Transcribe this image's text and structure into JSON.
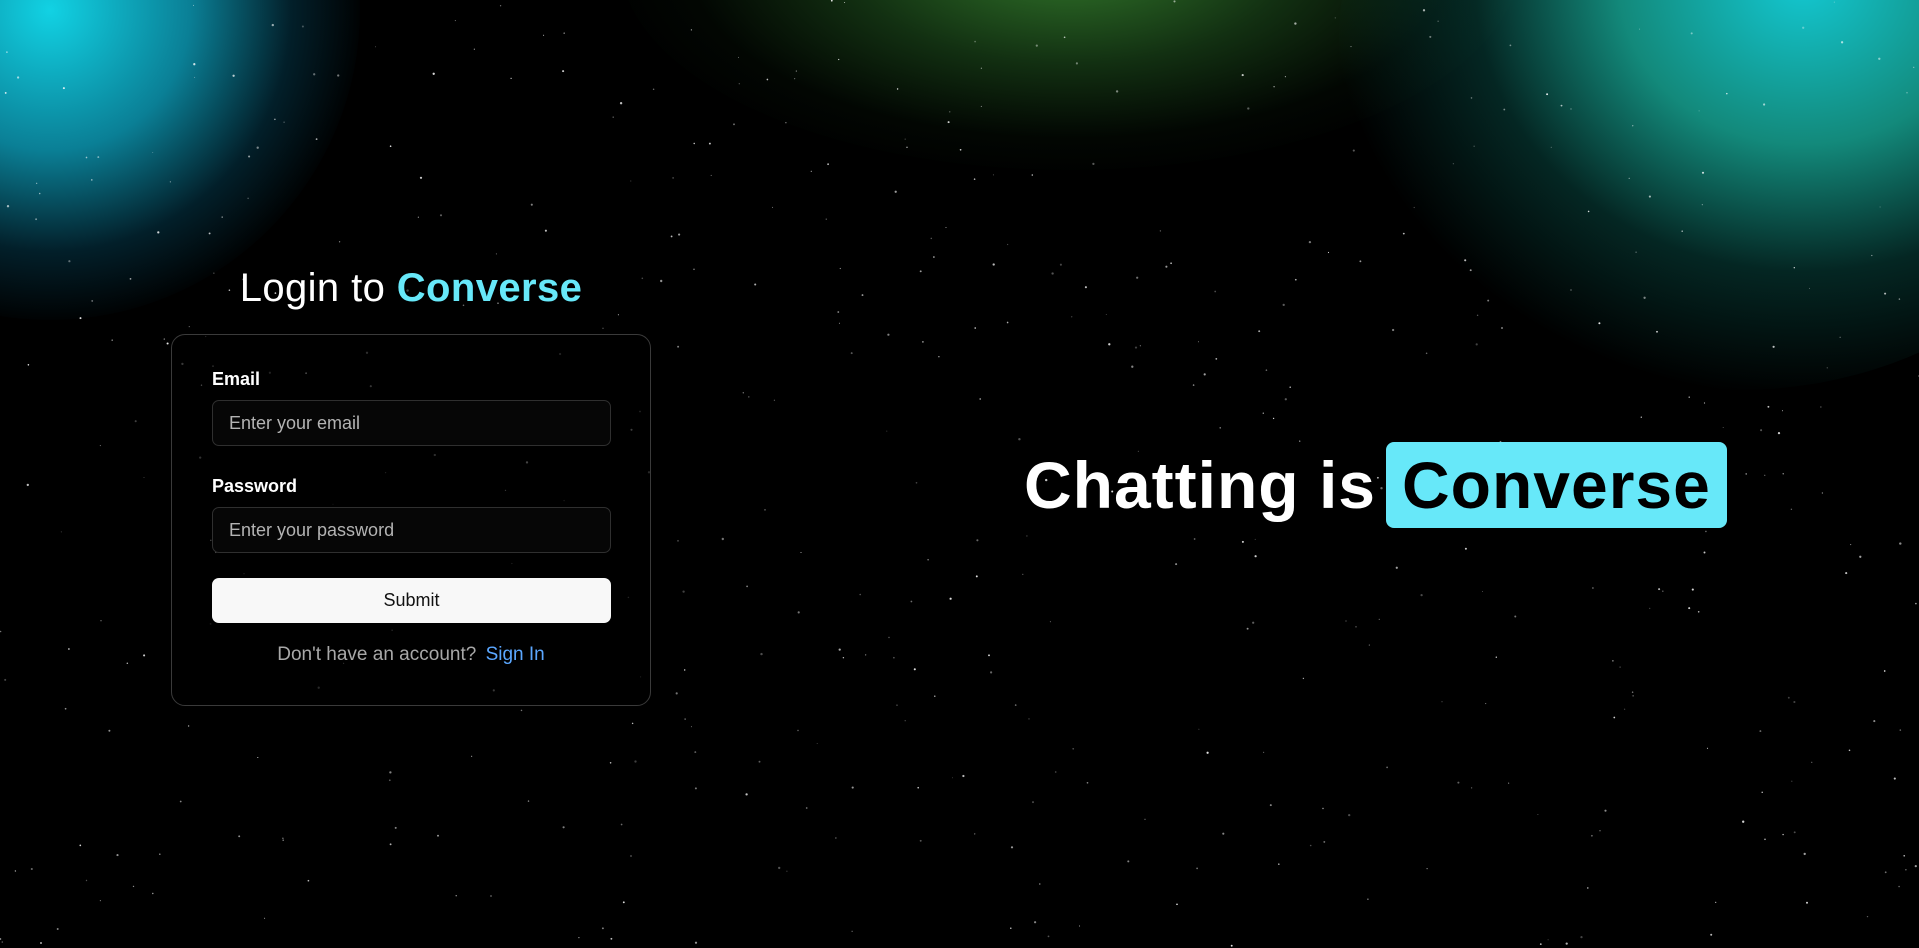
{
  "login": {
    "title_prefix": "Login to",
    "title_brand": "Converse",
    "email_label": "Email",
    "email_placeholder": "Enter your email",
    "password_label": "Password",
    "password_placeholder": "Enter your password",
    "submit_label": "Submit",
    "signup_prompt": "Don't have an account?",
    "signup_link": "Sign In"
  },
  "hero": {
    "prefix": "Chatting is",
    "badge": "Converse"
  },
  "theme": {
    "accent": "#67e8f9",
    "link": "#5ba7ff",
    "background": "#000000"
  }
}
